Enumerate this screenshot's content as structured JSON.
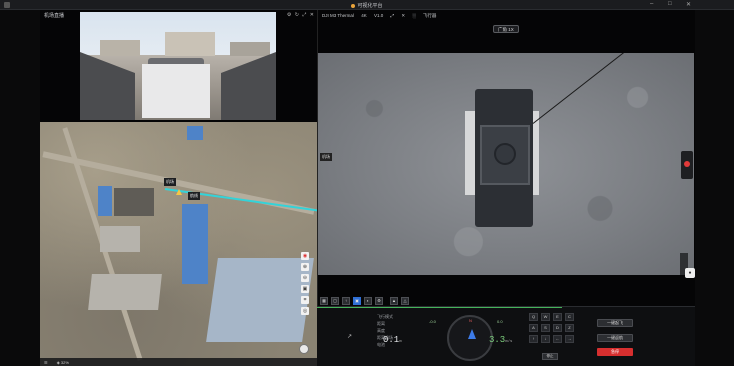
{
  "window": {
    "title": "可视化平台",
    "controls": [
      "–",
      "□",
      "✕"
    ]
  },
  "fpv": {
    "label": "机场直播",
    "icons": [
      "⚙",
      "↻",
      "⤢",
      "✕"
    ]
  },
  "main": {
    "header": [
      "DJI M3 Thermal",
      "4K",
      "V1.0",
      "⤢",
      "✕",
      "░",
      "飞行器"
    ],
    "mode_label": "广角 1X",
    "cam_tag": "机场",
    "side_labels": [
      "●"
    ]
  },
  "map": {
    "tag_1": "机场",
    "tag_2": "航线",
    "tools": [
      "◉",
      "⊕",
      "⊖",
      "▣",
      "⌗",
      "◎"
    ],
    "footer": [
      "☰",
      "◈ 32%"
    ]
  },
  "toolbar": {
    "buttons": [
      "▦",
      "▢",
      "↑",
      "▣",
      "◐",
      "⚙",
      "▲",
      "△"
    ]
  },
  "telemetry": {
    "lines": [
      "飞行模式",
      "距离",
      "高度",
      "距离机场",
      "电池"
    ],
    "altitude_value": "0.1",
    "altitude_unit": "m",
    "speed_value": "3.3",
    "speed_unit": "m/s",
    "attitude_left": "-0.0",
    "attitude_right": "0.0",
    "compass_n": "N"
  },
  "dpad": {
    "keys": [
      "Q",
      "W",
      "E",
      "C",
      "A",
      "S",
      "D",
      "Z",
      "↑",
      "↓",
      "←",
      "→"
    ],
    "center_button": "停止"
  },
  "actions": {
    "takeoff": "一键起飞",
    "return": "一键返航",
    "emergency": "急停"
  },
  "colors": {
    "accent": "#2f6fd6",
    "danger": "#d72f2f",
    "route": "#33d3d9",
    "status_ok": "#45b35a"
  }
}
